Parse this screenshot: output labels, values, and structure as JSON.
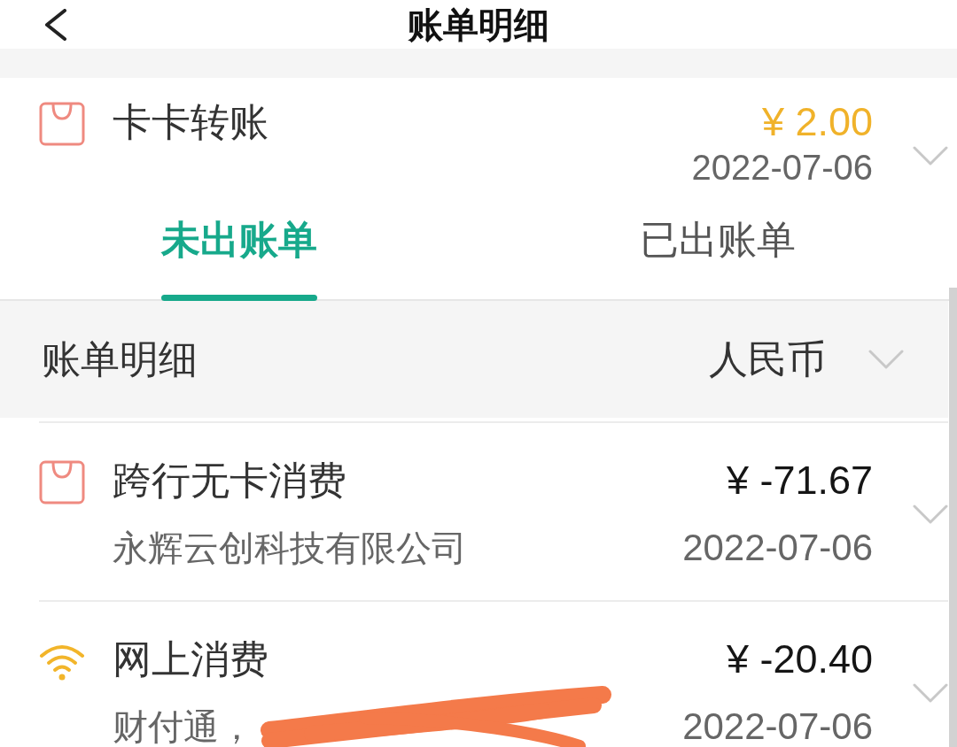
{
  "header": {
    "title": "账单明细"
  },
  "pinned_transaction": {
    "kind": "bag",
    "title": "卡卡转账",
    "amount": "¥ 2.00",
    "credit": true,
    "date": "2022-07-06",
    "expanded": false
  },
  "tabs": [
    {
      "label": "未出账单",
      "selected": true
    },
    {
      "label": "已出账单",
      "selected": false
    }
  ],
  "section": {
    "title": "账单明细",
    "currency": "人民币"
  },
  "transactions": [
    {
      "kind": "bag",
      "title": "跨行无卡消费",
      "amount": "¥ -71.67",
      "credit": false,
      "merchant": "永辉云创科技有限公司",
      "date": "2022-07-06",
      "expanded": false,
      "redacted": false
    },
    {
      "kind": "wifi",
      "title": "网上消费",
      "amount": "¥ -20.40",
      "credit": false,
      "merchant": "财付通，",
      "date": "2022-07-06",
      "expanded": false,
      "redacted": true
    }
  ]
}
